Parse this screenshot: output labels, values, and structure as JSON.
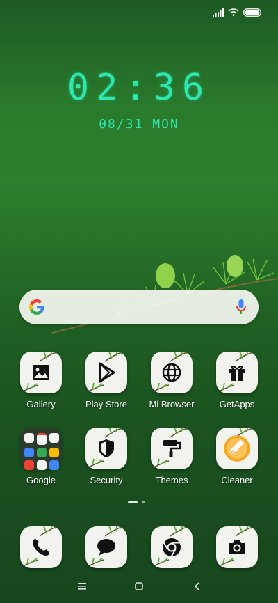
{
  "status_bar": {
    "icons": [
      "signal-icon",
      "wifi-icon",
      "battery-icon"
    ]
  },
  "clock": {
    "time": "02:36",
    "date": "08/31 MON",
    "color": "#2de6b0"
  },
  "search_bar": {
    "icons": [
      "google-g-icon",
      "microphone-icon"
    ]
  },
  "apps_row1": [
    {
      "label": "Gallery",
      "icon": "gallery-icon"
    },
    {
      "label": "Play Store",
      "icon": "play-store-icon"
    },
    {
      "label": "Mi Browser",
      "icon": "globe-icon"
    },
    {
      "label": "GetApps",
      "icon": "gift-icon"
    }
  ],
  "apps_row2": [
    {
      "label": "Google",
      "icon": "folder-icon"
    },
    {
      "label": "Security",
      "icon": "shield-icon"
    },
    {
      "label": "Themes",
      "icon": "paint-roller-icon"
    },
    {
      "label": "Cleaner",
      "icon": "broom-icon"
    }
  ],
  "dock": [
    {
      "icon": "phone-icon"
    },
    {
      "icon": "messages-icon"
    },
    {
      "icon": "chrome-icon"
    },
    {
      "icon": "camera-icon"
    }
  ],
  "page_indicator": {
    "pages": 2,
    "current": 1
  },
  "navigation": {
    "buttons": [
      "menu-icon",
      "home-icon",
      "back-icon"
    ]
  }
}
